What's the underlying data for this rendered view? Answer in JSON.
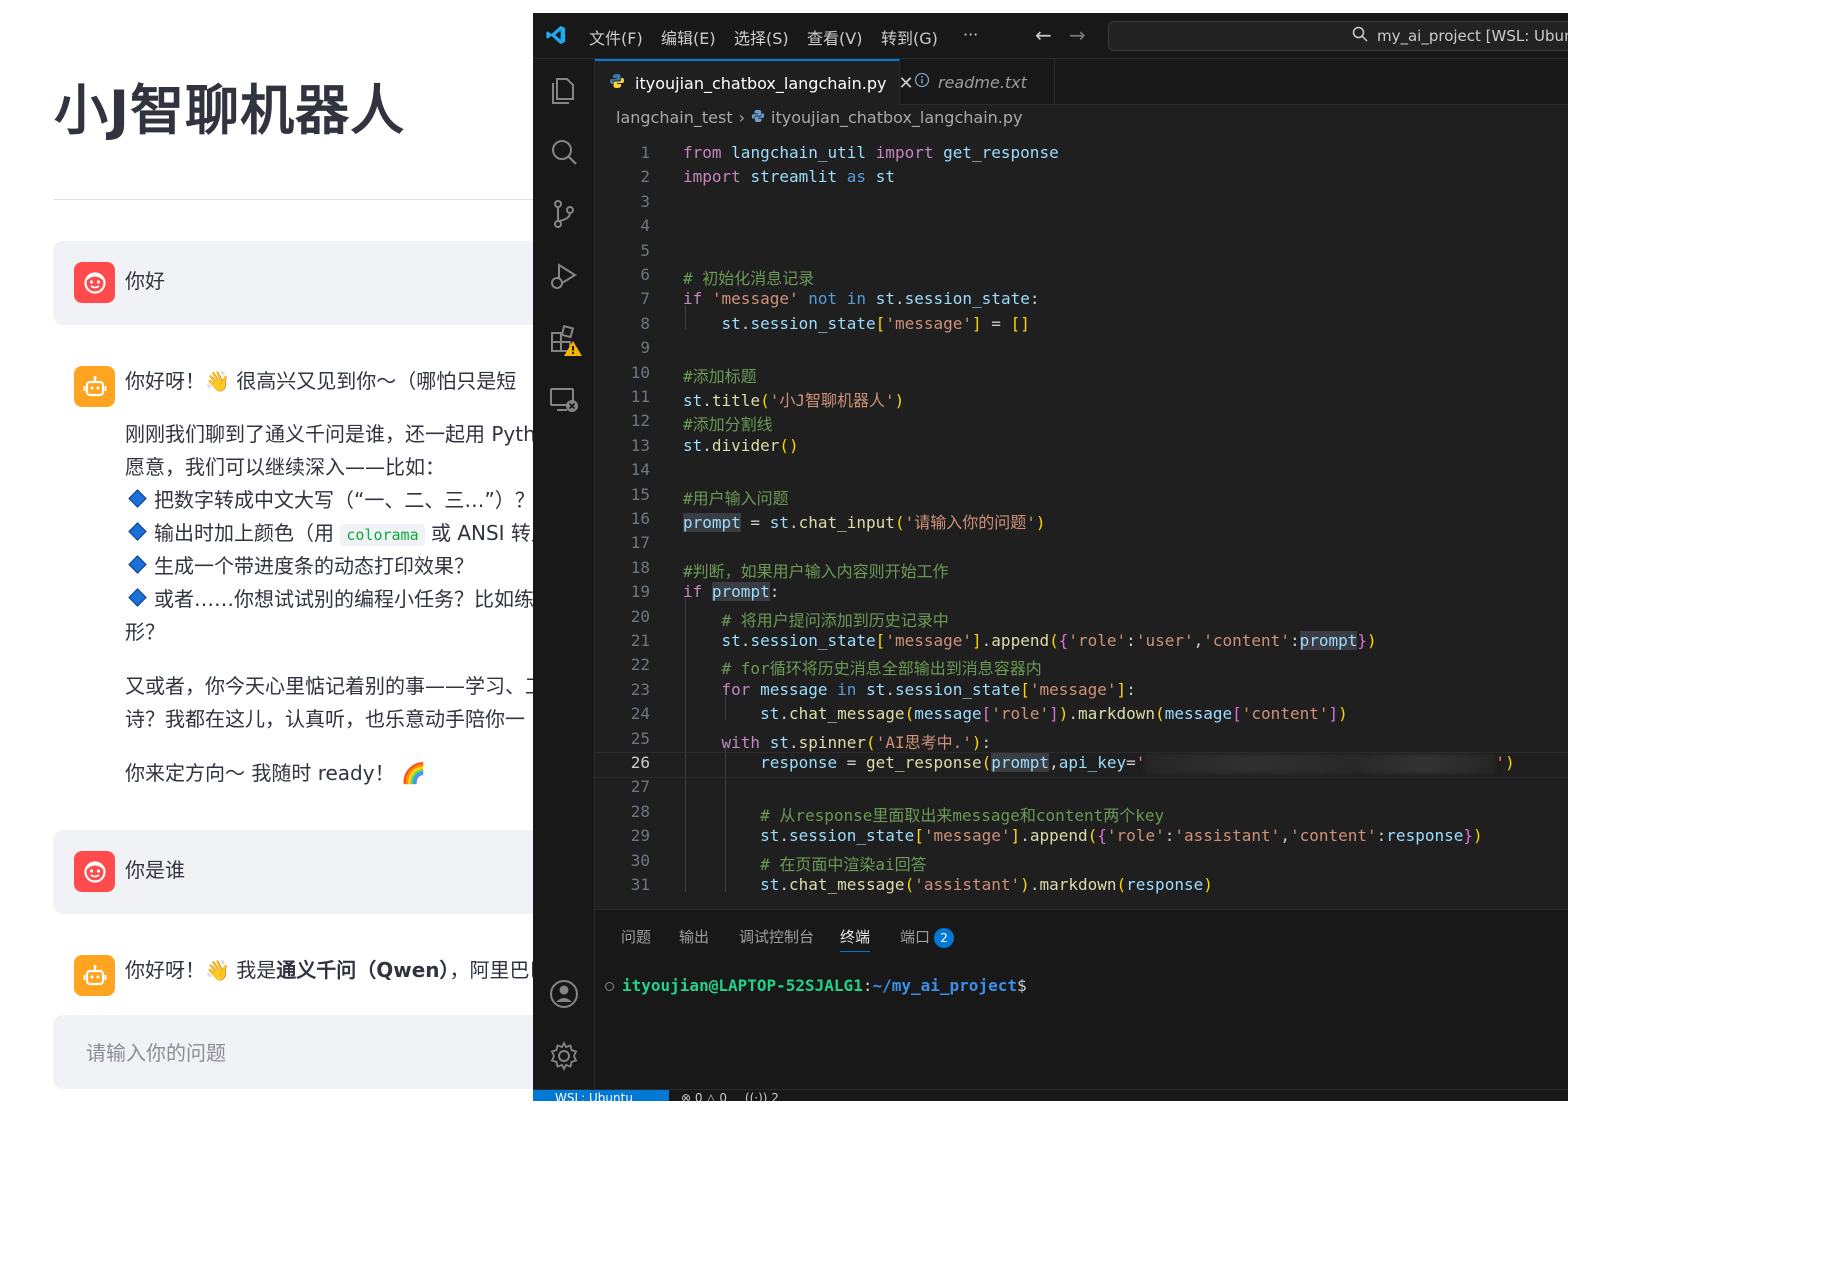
{
  "streamlit": {
    "title": "小J智聊机器人",
    "messages": [
      {
        "role": "user",
        "text": "你好"
      },
      {
        "role": "assistant",
        "first_line": "你好呀！👋 很高兴又见到你～（哪怕只是短",
        "para1_line1": "刚刚我们聊到了通义千问是谁，还一起用 Pyth",
        "para1_line2": "愿意，我们可以继续深入——比如：",
        "bullets": [
          "把数字转成中文大写（“一、二、三…”）？",
          "输出时加上颜色（用",
          "生成一个带进度条的动态打印效果？",
          "或者……你想试试别的编程小任务？比如练"
        ],
        "bullet2_code": "colorama",
        "bullet2_tail": "或 ANSI 转义",
        "bullet4_cont": "形？",
        "para2_line1": "又或者，你今天心里惦记着别的事——学习、工",
        "para2_line2": "诗？我都在这儿，认真听，也乐意动手陪你一",
        "closing": "你来定方向～ 我随时 ready！ 🌈"
      },
      {
        "role": "user",
        "text": "你是谁"
      },
      {
        "role": "assistant",
        "first_line_pre": "你好呀！👋 我是",
        "first_line_bold": "通义千问（Qwen）",
        "first_line_post": "，阿里巴巴"
      }
    ],
    "input_placeholder": "请输入你的问题"
  },
  "vscode": {
    "menu": [
      "文件(F)",
      "编辑(E)",
      "选择(S)",
      "查看(V)",
      "转到(G)",
      "···"
    ],
    "search_text": "my_ai_project [WSL: Ubuntu]",
    "tabs": [
      {
        "label": "ityoujian_chatbox_langchain.py",
        "active": true
      },
      {
        "label": "readme.txt",
        "active": false
      }
    ],
    "breadcrumb": [
      "langchain_test",
      "ityoujian_chatbox_langchain.py"
    ],
    "current_line": 26,
    "panel_tabs": [
      "问题",
      "输出",
      "调试控制台",
      "终端",
      "端口"
    ],
    "active_panel_tab": "终端",
    "ports_badge": "2",
    "terminal": {
      "user": "ityoujian@LAPTOP-52SJALG1",
      "path": "~/my_ai_project",
      "prompt": "$"
    },
    "status": {
      "remote": "WSL: Ubuntu",
      "errors": "0",
      "warnings": "0",
      "ports": "2"
    },
    "colors": {
      "accent": "#0078d4",
      "editor_bg": "#1f1f1f",
      "user_avatar": "#ff4b4b",
      "bot_avatar": "#ffa421"
    }
  },
  "code_lines": [
    "from langchain_util import get_response",
    "import streamlit as st",
    "",
    "",
    "",
    "# 初始化消息记录",
    "if 'message' not in st.session_state:",
    "    st.session_state['message'] = []",
    "",
    "#添加标题",
    "st.title('小J智聊机器人')",
    "#添加分割线",
    "st.divider()",
    "",
    "#用户输入问题",
    "prompt = st.chat_input('请输入你的问题')",
    "",
    "#判断，如果用户输入内容则开始工作",
    "if prompt:",
    "    # 将用户提问添加到历史记录中",
    "    st.session_state['message'].append({'role':'user','content':prompt})",
    "    # for循环将历史消息全部输出到消息容器内",
    "    for message in st.session_state['message']:",
    "        st.chat_message(message['role']).markdown(message['content'])",
    "    with st.spinner('AI思考中.'):",
    "        response = get_response(prompt,api_key='')",
    "",
    "        # 从response里面取出来message和content两个key",
    "        st.session_state['message'].append({'role':'assistant','content':response})",
    "        # 在页面中渲染ai回答",
    "        st.chat_message('assistant').markdown(response)"
  ]
}
